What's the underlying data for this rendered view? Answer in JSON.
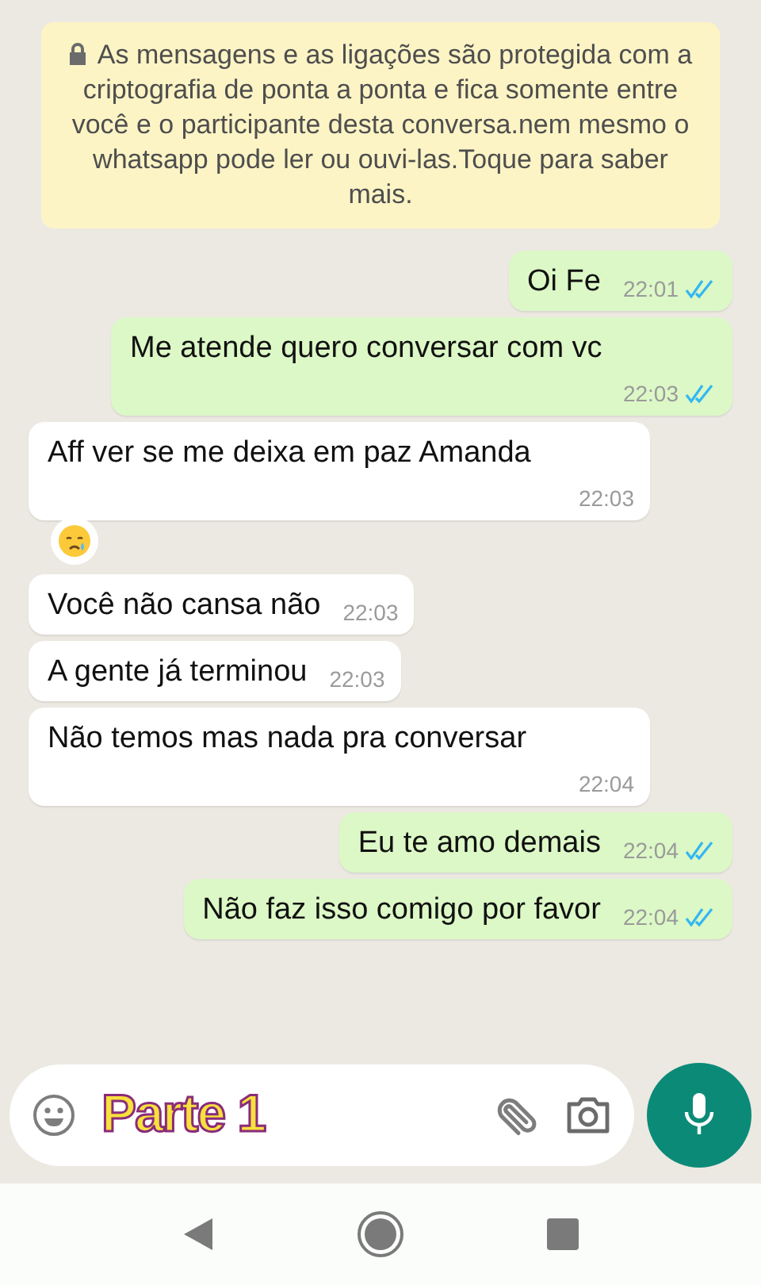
{
  "encryption_notice": "As mensagens e as ligações são protegida com a criptografia de ponta a ponta e fica somente entre você e o participante desta conversa.nem mesmo o whatsapp pode ler ou ouvi-las.Toque para saber mais.",
  "messages": [
    {
      "kind": "out",
      "text": "Oi Fe",
      "time": "22:01",
      "read": true,
      "time_below": false,
      "reaction": false
    },
    {
      "kind": "out",
      "text": "Me atende quero conversar com vc",
      "time": "22:03",
      "read": true,
      "time_below": true,
      "reaction": false
    },
    {
      "kind": "in",
      "text": "Aff ver se me deixa em paz Amanda",
      "time": "22:03",
      "time_below": true,
      "reaction": true
    },
    {
      "kind": "in",
      "text": "Você não cansa não",
      "time": "22:03",
      "time_below": false,
      "reaction": false
    },
    {
      "kind": "in",
      "text": "A gente já terminou",
      "time": "22:03",
      "time_below": false,
      "reaction": false
    },
    {
      "kind": "in",
      "text": "Não temos mas nada pra conversar",
      "time": "22:04",
      "time_below": true,
      "reaction": false
    },
    {
      "kind": "out",
      "text": "Eu te amo demais",
      "time": "22:04",
      "read": true,
      "time_below": false,
      "reaction": false
    },
    {
      "kind": "out",
      "text": "Não faz isso comigo por favor",
      "time": "22:04",
      "read": true,
      "time_below": false,
      "reaction": false
    }
  ],
  "caption_overlay": "Parte 1"
}
